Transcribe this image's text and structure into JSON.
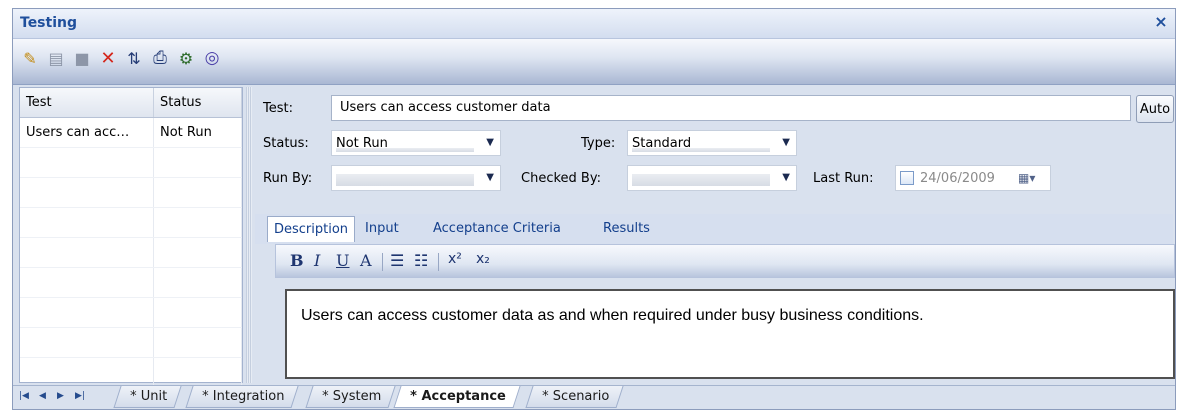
{
  "window": {
    "title": "Testing",
    "close_label": "×"
  },
  "toolbar": {
    "buttons": [
      {
        "icon": "new-icon",
        "glyph": "✎"
      },
      {
        "icon": "save-icon",
        "glyph": "▤"
      },
      {
        "icon": "copy-icon",
        "glyph": "■"
      },
      {
        "icon": "delete-icon",
        "glyph": "✕"
      },
      {
        "icon": "sort-icon",
        "glyph": "⇅"
      },
      {
        "icon": "print-icon",
        "glyph": "⎙"
      },
      {
        "icon": "properties-icon",
        "glyph": "⚙"
      },
      {
        "icon": "help-icon",
        "glyph": "◎"
      }
    ]
  },
  "grid": {
    "columns": [
      "Test",
      "Status"
    ],
    "rows": [
      {
        "test": "Users can acc…",
        "status": "Not Run"
      }
    ]
  },
  "form": {
    "test_label": "Test:",
    "test_value": "Users can access customer data",
    "auto_label": "Auto",
    "status_label": "Status:",
    "status_value": "Not Run",
    "type_label": "Type:",
    "type_value": "Standard",
    "runby_label": "Run By:",
    "runby_value": "",
    "checkedby_label": "Checked By:",
    "checkedby_value": "",
    "lastrun_label": "Last Run:",
    "lastrun_value": "24/06/2009"
  },
  "detail_tabs": [
    "Description",
    "Input",
    "Acceptance Criteria",
    "Results"
  ],
  "editor_toolbar": {
    "bold": "B",
    "italic": "I",
    "underline": "U",
    "font_color": "A",
    "bullets": "☰",
    "numbering": "☷",
    "superscript": "x²",
    "subscript": "x₂"
  },
  "editor_text": "Users can access customer data as and when required under busy business conditions.",
  "bottom_tabs": [
    "* Unit",
    "* Integration",
    "* System",
    "* Acceptance",
    "* Scenario"
  ],
  "colors": {
    "title": "#1f4f9c",
    "tab_text": "#133f8c",
    "panel": "#d9e1ee"
  }
}
